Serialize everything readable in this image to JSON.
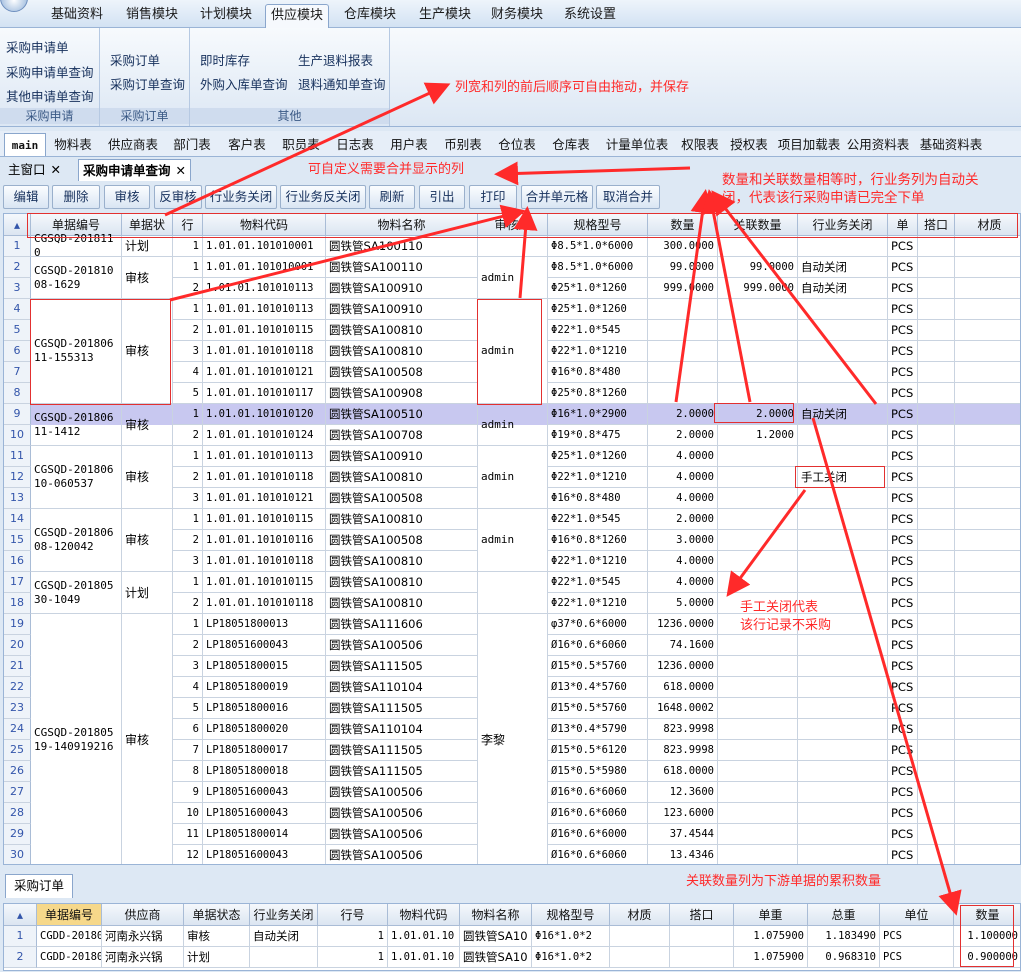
{
  "menu": [
    "基础资料",
    "销售模块",
    "计划模块",
    "供应模块",
    "仓库模块",
    "生产模块",
    "财务模块",
    "系统设置"
  ],
  "menu_active": 3,
  "ribbon": {
    "groups": [
      {
        "title": "采购申请",
        "items": [
          "采购申请单",
          "采购申请单查询",
          "其他申请单查询"
        ]
      },
      {
        "title": "采购订单",
        "items": [
          "采购订单",
          "采购订单查询"
        ]
      },
      {
        "title": "其他",
        "items": [
          "即时库存",
          "外购入库单查询",
          "生产退料报表",
          "退料通知单查询"
        ]
      }
    ]
  },
  "tabs": [
    "main",
    "物料表",
    "供应商表",
    "部门表",
    "客户表",
    "职员表",
    "日志表",
    "用户表",
    "币别表",
    "仓位表",
    "仓库表",
    "计量单位表",
    "权限表",
    "授权表",
    "项目加载表",
    "公用资料表",
    "基础资料表"
  ],
  "window_tabs": [
    "主窗口",
    "采购申请单查询"
  ],
  "toolbar": [
    "编辑",
    "删除",
    "审核",
    "反审核",
    "行业务关闭",
    "行业务反关闭",
    "刷新",
    "引出",
    "打印",
    "合并单元格",
    "取消合并"
  ],
  "grid": {
    "headers": [
      "单据编号",
      "单据状",
      "行",
      "物料代码",
      "物料名称",
      "审核人",
      "规格型号",
      "数量",
      "关联数量",
      "行业务关闭",
      "单",
      "搭口",
      "材质"
    ],
    "rows": [
      [
        "1",
        "1.01.01.101010001",
        "圆铁管SA100110",
        "Φ8.5*1.0*6000",
        "300.0000",
        "",
        "",
        "PCS"
      ],
      [
        "1",
        "1.01.01.101010001",
        "圆铁管SA100110",
        "Φ8.5*1.0*6000",
        "99.0000",
        "99.0000",
        "自动关闭",
        "PCS"
      ],
      [
        "2",
        "1.01.01.101010113",
        "圆铁管SA100910",
        "Φ25*1.0*1260",
        "999.0000",
        "999.0000",
        "自动关闭",
        "PCS"
      ],
      [
        "1",
        "1.01.01.101010113",
        "圆铁管SA100910",
        "Φ25*1.0*1260",
        "",
        "",
        "",
        "PCS"
      ],
      [
        "2",
        "1.01.01.101010115",
        "圆铁管SA100810",
        "Φ22*1.0*545",
        "",
        "",
        "",
        "PCS"
      ],
      [
        "3",
        "1.01.01.101010118",
        "圆铁管SA100810",
        "Φ22*1.0*1210",
        "",
        "",
        "",
        "PCS"
      ],
      [
        "4",
        "1.01.01.101010121",
        "圆铁管SA100508",
        "Φ16*0.8*480",
        "",
        "",
        "",
        "PCS"
      ],
      [
        "5",
        "1.01.01.101010117",
        "圆铁管SA100908",
        "Φ25*0.8*1260",
        "",
        "",
        "",
        "PCS"
      ],
      [
        "1",
        "1.01.01.101010120",
        "圆铁管SA100510",
        "Φ16*1.0*2900",
        "2.0000",
        "2.0000",
        "自动关闭",
        "PCS"
      ],
      [
        "2",
        "1.01.01.101010124",
        "圆铁管SA100708",
        "Φ19*0.8*475",
        "2.0000",
        "1.2000",
        "",
        "PCS"
      ],
      [
        "1",
        "1.01.01.101010113",
        "圆铁管SA100910",
        "Φ25*1.0*1260",
        "4.0000",
        "",
        "",
        "PCS"
      ],
      [
        "2",
        "1.01.01.101010118",
        "圆铁管SA100810",
        "Φ22*1.0*1210",
        "4.0000",
        "",
        "手工关闭",
        "PCS"
      ],
      [
        "3",
        "1.01.01.101010121",
        "圆铁管SA100508",
        "Φ16*0.8*480",
        "4.0000",
        "",
        "",
        "PCS"
      ],
      [
        "1",
        "1.01.01.101010115",
        "圆铁管SA100810",
        "Φ22*1.0*545",
        "2.0000",
        "",
        "",
        "PCS"
      ],
      [
        "2",
        "1.01.01.101010116",
        "圆铁管SA100508",
        "Φ16*0.8*1260",
        "3.0000",
        "",
        "",
        "PCS"
      ],
      [
        "3",
        "1.01.01.101010118",
        "圆铁管SA100810",
        "Φ22*1.0*1210",
        "4.0000",
        "",
        "",
        "PCS"
      ],
      [
        "1",
        "1.01.01.101010115",
        "圆铁管SA100810",
        "Φ22*1.0*545",
        "4.0000",
        "",
        "",
        "PCS"
      ],
      [
        "2",
        "1.01.01.101010118",
        "圆铁管SA100810",
        "Φ22*1.0*1210",
        "5.0000",
        "",
        "",
        "PCS"
      ],
      [
        "1",
        "LP18051800013",
        "圆铁管SA111606",
        "φ37*0.6*6000",
        "1236.0000",
        "",
        "",
        "PCS"
      ],
      [
        "2",
        "LP18051600043",
        "圆铁管SA100506",
        "Ø16*0.6*6060",
        "74.1600",
        "",
        "",
        "PCS"
      ],
      [
        "3",
        "LP18051800015",
        "圆铁管SA111505",
        "Ø15*0.5*5760",
        "1236.0000",
        "",
        "",
        "PCS"
      ],
      [
        "4",
        "LP18051800019",
        "圆铁管SA110104",
        "Ø13*0.4*5760",
        "618.0000",
        "",
        "",
        "PCS"
      ],
      [
        "5",
        "LP18051800016",
        "圆铁管SA111505",
        "Ø15*0.5*5760",
        "1648.0002",
        "",
        "",
        "PCS"
      ],
      [
        "6",
        "LP18051800020",
        "圆铁管SA110104",
        "Ø13*0.4*5790",
        "823.9998",
        "",
        "",
        "PCS"
      ],
      [
        "7",
        "LP18051800017",
        "圆铁管SA111505",
        "Ø15*0.5*6120",
        "823.9998",
        "",
        "",
        "PCS"
      ],
      [
        "8",
        "LP18051800018",
        "圆铁管SA111505",
        "Ø15*0.5*5980",
        "618.0000",
        "",
        "",
        "PCS"
      ],
      [
        "9",
        "LP18051600043",
        "圆铁管SA100506",
        "Ø16*0.6*6060",
        "12.3600",
        "",
        "",
        "PCS"
      ],
      [
        "10",
        "LP18051600043",
        "圆铁管SA100506",
        "Ø16*0.6*6060",
        "123.6000",
        "",
        "",
        "PCS"
      ],
      [
        "11",
        "LP18051800014",
        "圆铁管SA100506",
        "Ø16*0.6*6000",
        "37.4544",
        "",
        "",
        "PCS"
      ],
      [
        "12",
        "LP18051600043",
        "圆铁管SA100506",
        "Ø16*0.6*6060",
        "13.4346",
        "",
        "",
        "PCS"
      ]
    ],
    "merges": [
      {
        "start": 0,
        "span": 1,
        "no": "CGSQD-2018110",
        "status": "计划",
        "auditor": ""
      },
      {
        "start": 1,
        "span": 2,
        "no": "CGSQD-20181008-1629",
        "status": "审核",
        "auditor": "admin"
      },
      {
        "start": 3,
        "span": 5,
        "no": "CGSQD-20180611-155313",
        "status": "审核",
        "auditor": "admin"
      },
      {
        "start": 8,
        "span": 2,
        "no": "CGSQD-20180611-1412",
        "status": "审核",
        "auditor": "admin"
      },
      {
        "start": 10,
        "span": 3,
        "no": "CGSQD-20180610-060537",
        "status": "审核",
        "auditor": "admin"
      },
      {
        "start": 13,
        "span": 3,
        "no": "CGSQD-20180608-120042",
        "status": "审核",
        "auditor": "admin"
      },
      {
        "start": 16,
        "span": 2,
        "no": "CGSQD-20180530-1049",
        "status": "计划",
        "auditor": ""
      },
      {
        "start": 18,
        "span": 12,
        "no": "CGSQD-20180519-140919216",
        "status": "审核",
        "auditor": "李黎"
      }
    ],
    "selected_row": 8
  },
  "lower_tab": "采购订单",
  "lower": {
    "headers": [
      "单据编号",
      "供应商",
      "单据状态",
      "行业务关闭",
      "行号",
      "物料代码",
      "物料名称",
      "规格型号",
      "材质",
      "搭口",
      "单重",
      "总重",
      "单位",
      "数量"
    ],
    "rows": [
      [
        "1",
        "CGDD-20180",
        "河南永兴锅",
        "审核",
        "自动关闭",
        "1",
        "1.01.01.10",
        "圆铁管SA10",
        "Φ16*1.0*2",
        "",
        "",
        "1.075900",
        "1.183490",
        "PCS",
        "1.100000"
      ],
      [
        "2",
        "CGDD-20180",
        "河南永兴锅",
        "计划",
        "",
        "1",
        "1.01.01.10",
        "圆铁管SA10",
        "Φ16*1.0*2",
        "",
        "",
        "1.075900",
        "0.968310",
        "PCS",
        "0.900000"
      ]
    ]
  },
  "annotations": {
    "a1": "列宽和列的前后顺序可自由拖动，并保存",
    "a2": "可自定义需要合并显示的列",
    "a3": "数量和关联数量相等时，行业务列为自动关",
    "a3b": "闭，代表该行采购申请已完全下单",
    "a4": "手工关闭代表",
    "a4b": "该行记录不采购",
    "a5": "关联数量列为下游单据的累积数量"
  },
  "colors": {
    "accent": "#ff2a2a",
    "selected": "#c8c8f0"
  }
}
